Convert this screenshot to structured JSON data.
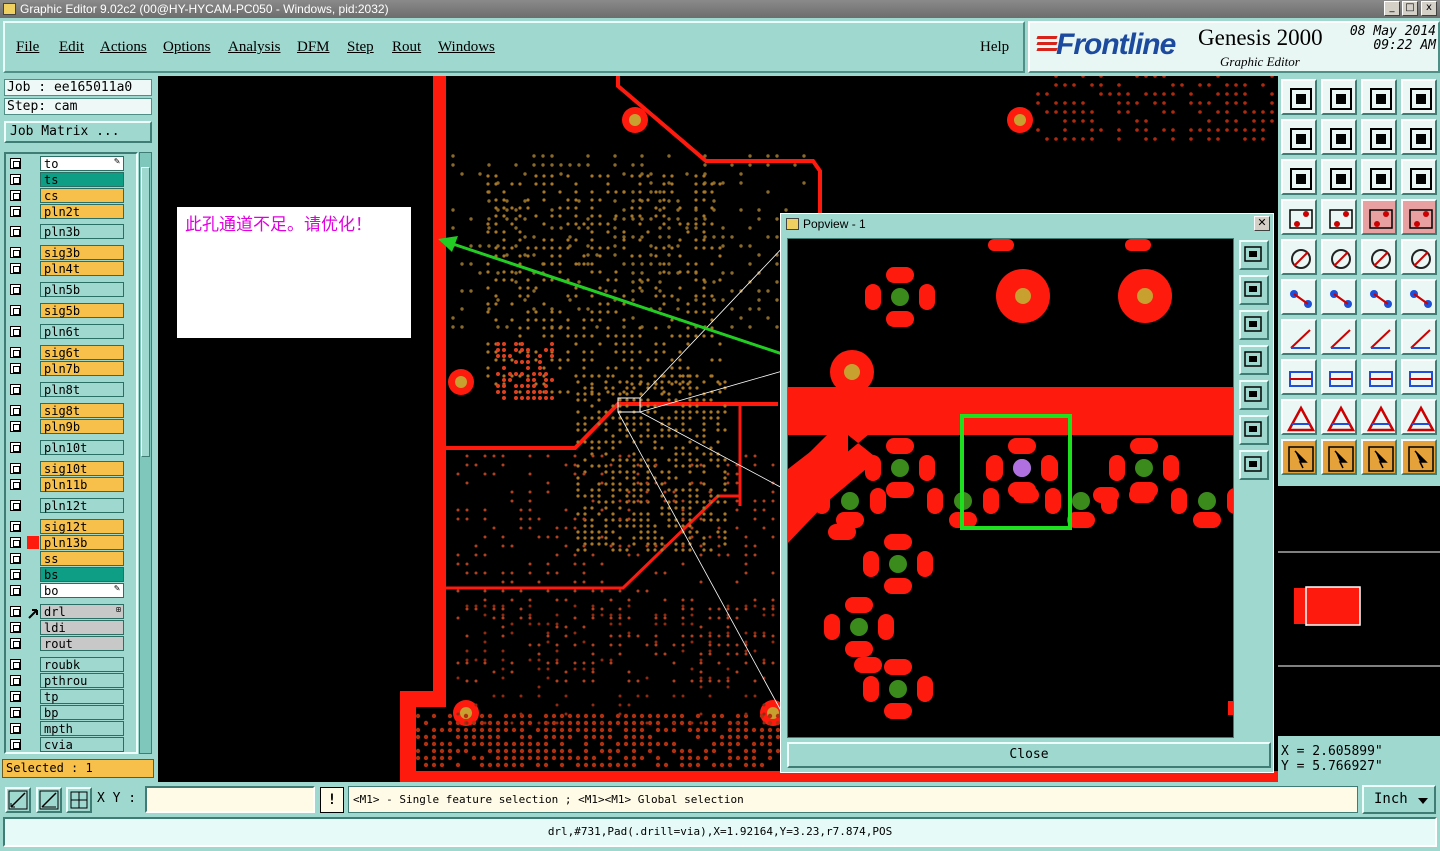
{
  "window": {
    "title": "Graphic Editor 9.02c2 (00@HY-HYCAM-PC050 - Windows, pid:2032)",
    "buttons": [
      "_",
      "□",
      "x"
    ]
  },
  "menu": {
    "items": [
      "File",
      "Edit",
      "Actions",
      "Options",
      "Analysis",
      "DFM",
      "Step",
      "Rout",
      "Windows"
    ],
    "help": "Help"
  },
  "brand": {
    "logo": "Frontline",
    "product": "Genesis 2000",
    "subtitle": "Graphic Editor",
    "date": "08 May 2014",
    "time": "09:22 AM"
  },
  "job": {
    "job_label": "Job : ee165011a0",
    "step_label": "Step: cam",
    "matrix_button": "Job Matrix ..."
  },
  "layers": [
    {
      "name": "to",
      "color": "#ffffff",
      "mark": "none"
    },
    {
      "name": "ts",
      "color": "#0e9e86",
      "mark": "none"
    },
    {
      "name": "cs",
      "color": "#f7c04a",
      "mark": "none"
    },
    {
      "name": "pln2t",
      "color": "#f7c04a",
      "mark": "none"
    },
    {
      "name": "pln3b",
      "color": "#9ed8cf",
      "mark": "none"
    },
    {
      "name": "sig3b",
      "color": "#f7c04a",
      "mark": "none"
    },
    {
      "name": "pln4t",
      "color": "#f7c04a",
      "mark": "none"
    },
    {
      "name": "pln5b",
      "color": "#9ed8cf",
      "mark": "none"
    },
    {
      "name": "sig5b",
      "color": "#f7c04a",
      "mark": "none"
    },
    {
      "name": "pln6t",
      "color": "#9ed8cf",
      "mark": "none"
    },
    {
      "name": "sig6t",
      "color": "#f7c04a",
      "mark": "none"
    },
    {
      "name": "pln7b",
      "color": "#f7c04a",
      "mark": "none"
    },
    {
      "name": "pln8t",
      "color": "#9ed8cf",
      "mark": "none"
    },
    {
      "name": "sig8t",
      "color": "#f7c04a",
      "mark": "none"
    },
    {
      "name": "pln9b",
      "color": "#f7c04a",
      "mark": "none"
    },
    {
      "name": "pln10t",
      "color": "#9ed8cf",
      "mark": "none"
    },
    {
      "name": "sig10t",
      "color": "#f7c04a",
      "mark": "none"
    },
    {
      "name": "pln11b",
      "color": "#f7c04a",
      "mark": "none"
    },
    {
      "name": "pln12t",
      "color": "#9ed8cf",
      "mark": "none"
    },
    {
      "name": "sig12t",
      "color": "#f7c04a",
      "mark": "none"
    },
    {
      "name": "pln13b",
      "color": "#f7c04a",
      "mark": "red"
    },
    {
      "name": "ss",
      "color": "#f7c04a",
      "mark": "none"
    },
    {
      "name": "bs",
      "color": "#0e9e86",
      "mark": "none"
    },
    {
      "name": "bo",
      "color": "#ffffff",
      "mark": "none"
    },
    {
      "name": "drl",
      "color": "#c8c8c8",
      "mark": "work"
    },
    {
      "name": "ldi",
      "color": "#c8c8c8",
      "mark": "none"
    },
    {
      "name": "rout",
      "color": "#c8c8c8",
      "mark": "none"
    },
    {
      "name": "roubk",
      "color": "#9ed8cf",
      "mark": "none"
    },
    {
      "name": "pthrou",
      "color": "#9ed8cf",
      "mark": "none"
    },
    {
      "name": "tp",
      "color": "#9ed8cf",
      "mark": "none"
    },
    {
      "name": "bp",
      "color": "#9ed8cf",
      "mark": "none"
    },
    {
      "name": "mpth",
      "color": "#9ed8cf",
      "mark": "none"
    },
    {
      "name": "cvia",
      "color": "#9ed8cf",
      "mark": "none"
    }
  ],
  "selected": "Selected : 1",
  "note": {
    "text": "此孔通道不足。请优化！"
  },
  "popview": {
    "title": "Popview - 1",
    "close": "Close"
  },
  "coords": {
    "x": "X = 2.605899\"",
    "y": "Y = 5.766927\""
  },
  "bottom": {
    "xy_label": "X Y :",
    "xy_value": "",
    "excl": "!",
    "hint": "<M1> - Single feature selection ; <M1><M1> Global selection",
    "units": "Inch",
    "status": "drl,#731,Pad(.drill=via),X=1.92164,Y=3.23,r7.874,POS"
  },
  "colors": {
    "copper": "#ff1a0e",
    "drill_pad": "#c8a030",
    "via_green": "#3a8a1c",
    "selected_via": "#b070e0",
    "highlight": "#1ee01e",
    "arrow": "#22cc22"
  }
}
